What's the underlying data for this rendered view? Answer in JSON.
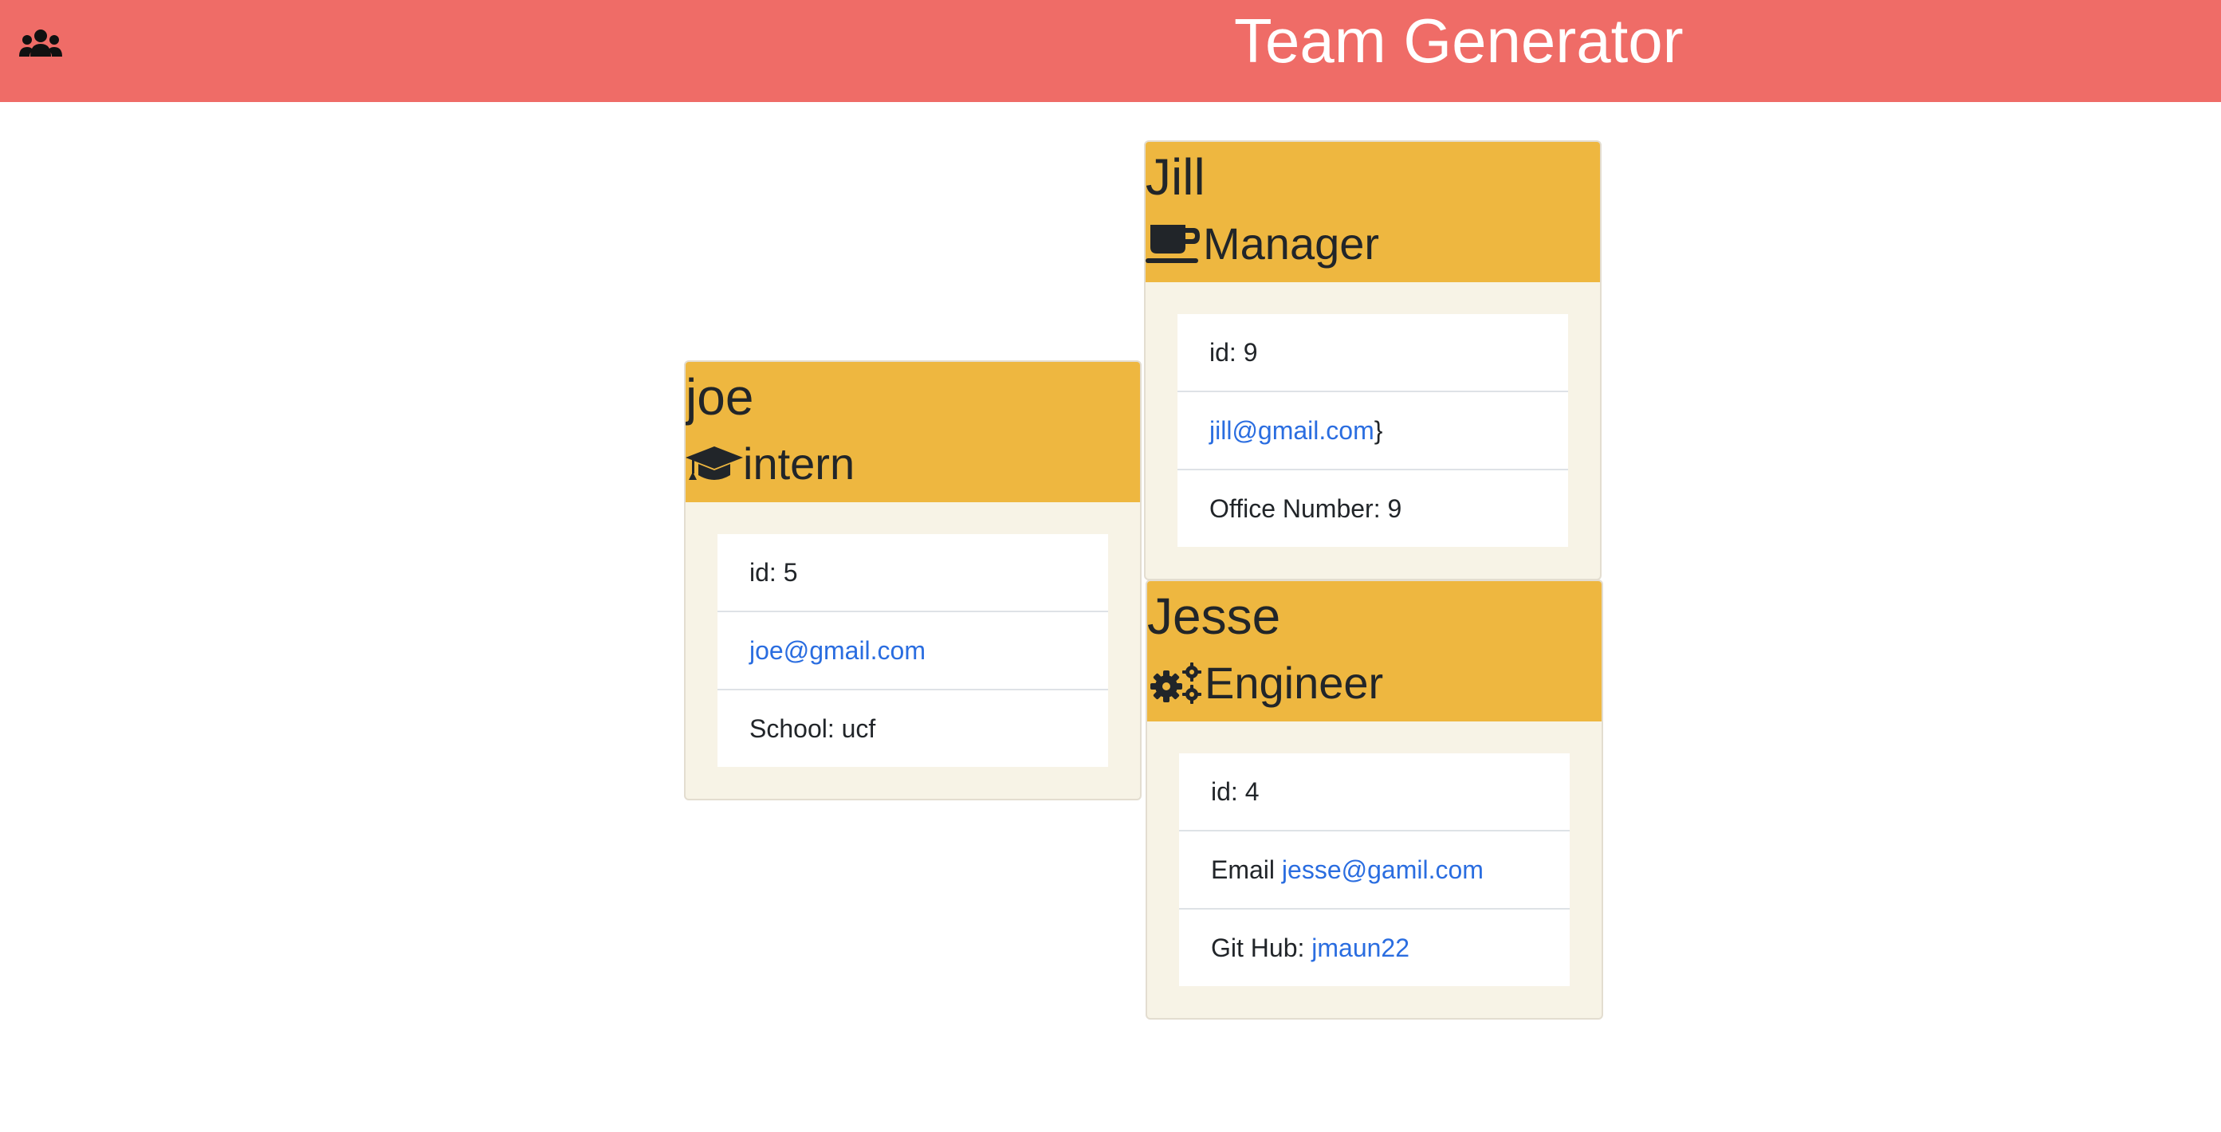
{
  "navbar": {
    "icon": "users-icon",
    "title": "Team Generator",
    "bg_color": "#ef6c67"
  },
  "employees": [
    {
      "name": "joe",
      "role": "intern",
      "role_icon": "graduation-cap-icon",
      "id_text": "id: 5",
      "email": "joe@gmail.com",
      "extra_prefix": "School: ucf"
    },
    {
      "name": "Jill",
      "role": "Manager",
      "role_icon": "coffee-mug-icon",
      "id_text": "id: 9",
      "email": "jill@gmail.com",
      "email_suffix": "}",
      "extra_prefix": "Office Number: 9"
    },
    {
      "name": "Jesse",
      "role": "Engineer",
      "role_icon": "cogs-icon",
      "id_text": "id: 4",
      "email_prefix": "Email ",
      "email": "jesse@gamil.com",
      "extra_prefix": "Git Hub: ",
      "extra_link": "jmaun22"
    }
  ],
  "colors": {
    "header": "#eeb740",
    "card_body": "#f7f3e6",
    "link": "#2a6de0"
  }
}
